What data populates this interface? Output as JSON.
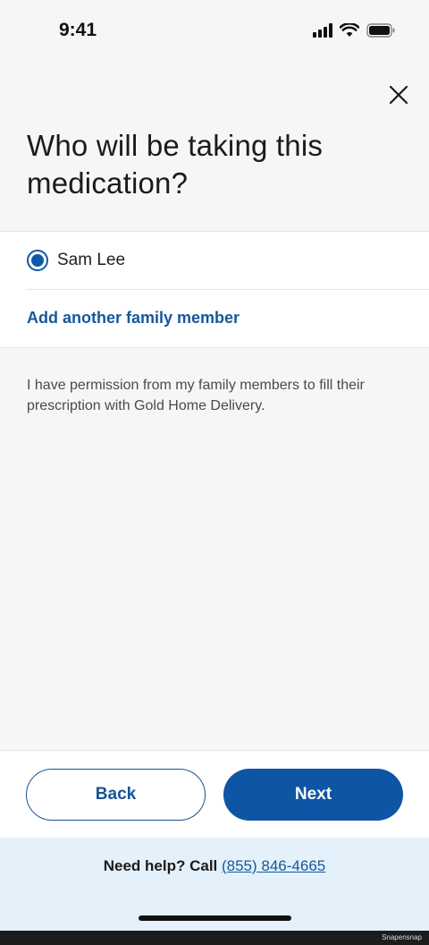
{
  "status_bar": {
    "time": "9:41",
    "icons": [
      "signal-icon",
      "wifi-icon",
      "battery-icon"
    ]
  },
  "header": {
    "close_icon": "close-icon",
    "title": "Who will be taking this medication?"
  },
  "options": {
    "members": [
      {
        "name": "Sam Lee",
        "selected": true
      }
    ],
    "add_link": "Add another family member"
  },
  "permission_text": "I have permission from my family members to fill their prescription with Gold Home Delivery.",
  "actions": {
    "back_label": "Back",
    "next_label": "Next"
  },
  "help": {
    "prefix": "Need help? Call ",
    "phone": "(855) 846-4665"
  },
  "watermark": "Snapensnap",
  "colors": {
    "primary": "#0f55a6",
    "link": "#15589c",
    "help_background": "#e4f0fa",
    "page_background": "#f6f6f4"
  }
}
